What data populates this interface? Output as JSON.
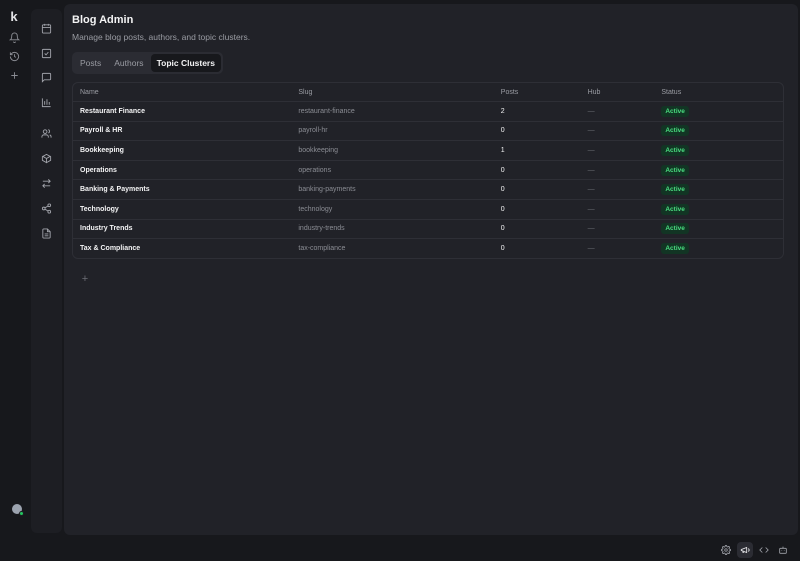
{
  "rail": {
    "logo": "k"
  },
  "page": {
    "title": "Blog Admin",
    "subtitle": "Manage blog posts, authors, and topic clusters."
  },
  "tabs": [
    {
      "label": "Posts",
      "active": false
    },
    {
      "label": "Authors",
      "active": false
    },
    {
      "label": "Topic Clusters",
      "active": true
    }
  ],
  "table": {
    "columns": [
      "Name",
      "Slug",
      "Posts",
      "Hub",
      "Status"
    ],
    "rows": [
      {
        "name": "Restaurant Finance",
        "slug": "restaurant-finance",
        "posts": "2",
        "hub": "—",
        "status": "Active"
      },
      {
        "name": "Payroll & HR",
        "slug": "payroll-hr",
        "posts": "0",
        "hub": "—",
        "status": "Active"
      },
      {
        "name": "Bookkeeping",
        "slug": "bookkeeping",
        "posts": "1",
        "hub": "—",
        "status": "Active"
      },
      {
        "name": "Operations",
        "slug": "operations",
        "posts": "0",
        "hub": "—",
        "status": "Active"
      },
      {
        "name": "Banking & Payments",
        "slug": "banking-payments",
        "posts": "0",
        "hub": "—",
        "status": "Active"
      },
      {
        "name": "Technology",
        "slug": "technology",
        "posts": "0",
        "hub": "—",
        "status": "Active"
      },
      {
        "name": "Industry Trends",
        "slug": "industry-trends",
        "posts": "0",
        "hub": "—",
        "status": "Active"
      },
      {
        "name": "Tax & Compliance",
        "slug": "tax-compliance",
        "posts": "0",
        "hub": "—",
        "status": "Active"
      }
    ]
  },
  "add_button": {
    "label": "+"
  },
  "colors": {
    "accent_status_bg": "#123524",
    "accent_status_fg": "#4ade80",
    "background": "#17181c",
    "panel": "#212228"
  },
  "icons": {
    "rail": [
      "bell-icon",
      "history-icon",
      "plus-icon"
    ],
    "sidebar": [
      "calendar-icon",
      "checkbox-icon",
      "chat-icon",
      "bar-chart-icon",
      "users-icon",
      "box-icon",
      "swap-icon",
      "share-icon",
      "document-icon"
    ],
    "bottom": [
      "settings-icon",
      "megaphone-icon",
      "code-icon",
      "bot-icon"
    ]
  }
}
